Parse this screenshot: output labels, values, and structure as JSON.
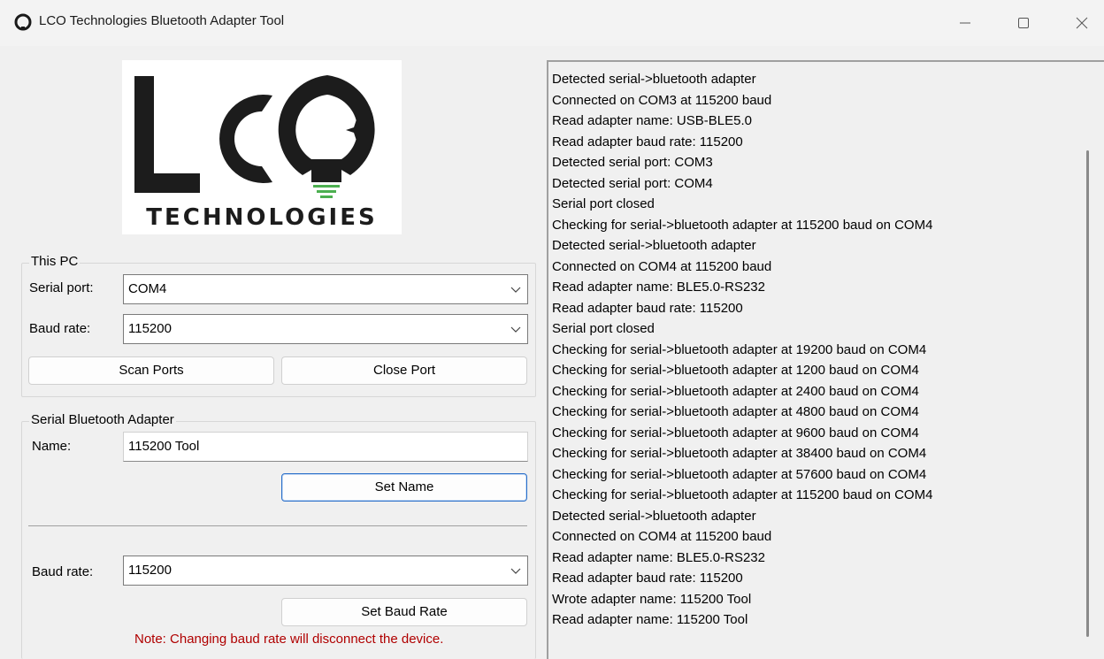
{
  "window": {
    "title": "LCO Technologies Bluetooth Adapter Tool",
    "minimize_glyph": "—",
    "maximize_glyph": "☐",
    "close_glyph": "✕"
  },
  "logo": {
    "wordmark": "LCO",
    "subtitle": "TECHNOLOGIES",
    "accent_color": "#4caf50"
  },
  "this_pc": {
    "group_title": "This PC",
    "serial_port_label": "Serial port:",
    "serial_port_value": "COM4",
    "baud_rate_label": "Baud rate:",
    "baud_rate_value": "115200",
    "scan_ports_label": "Scan Ports",
    "close_port_label": "Close Port"
  },
  "adapter": {
    "group_title": "Serial Bluetooth Adapter",
    "name_label": "Name:",
    "name_value": "115200 Tool",
    "set_name_label": "Set Name",
    "baud_rate_label": "Baud rate:",
    "baud_rate_value": "115200",
    "set_baud_label": "Set Baud Rate",
    "note": "Note: Changing baud rate will disconnect the device."
  },
  "log": {
    "lines": [
      "Detected serial->bluetooth adapter",
      "Connected on COM3 at 115200 baud",
      "Read adapter name: USB-BLE5.0",
      "Read adapter baud rate: 115200",
      "Detected serial port: COM3",
      "Detected serial port: COM4",
      "Serial port closed",
      "Checking for serial->bluetooth adapter at 115200 baud on COM4",
      "Detected serial->bluetooth adapter",
      "Connected on COM4 at 115200 baud",
      "Read adapter name: BLE5.0-RS232",
      "Read adapter baud rate: 115200",
      "Serial port closed",
      "Checking for serial->bluetooth adapter at 19200 baud on COM4",
      "Checking for serial->bluetooth adapter at 1200 baud on COM4",
      "Checking for serial->bluetooth adapter at 2400 baud on COM4",
      "Checking for serial->bluetooth adapter at 4800 baud on COM4",
      "Checking for serial->bluetooth adapter at 9600 baud on COM4",
      "Checking for serial->bluetooth adapter at 38400 baud on COM4",
      "Checking for serial->bluetooth adapter at 57600 baud on COM4",
      "Checking for serial->bluetooth adapter at 115200 baud on COM4",
      "Detected serial->bluetooth adapter",
      "Connected on COM4 at 115200 baud",
      "Read adapter name: BLE5.0-RS232",
      "Read adapter baud rate: 115200",
      "Wrote adapter name: 115200 Tool",
      "Read adapter name: 115200 Tool"
    ]
  }
}
